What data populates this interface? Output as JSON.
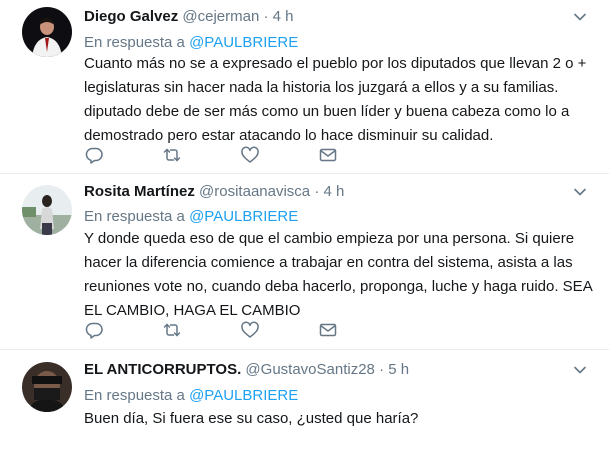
{
  "tweets": [
    {
      "name": "Diego Galvez",
      "handle": "@cejerman",
      "dot": "·",
      "time": "4 h",
      "reply_prefix": "En respuesta a",
      "reply_to": "@PAULBRIERE",
      "text": "Cuanto más no se a expresado el pueblo por los diputados que llevan 2 o + legislaturas sin hacer nada la historia los juzgará a ellos y a su familias. diputado debe de ser más como un buen líder y buena cabeza como lo a demostrado pero estar atacando lo hace disminuir su calidad."
    },
    {
      "name": "Rosita Martínez",
      "handle": "@rositaanavisca",
      "dot": "·",
      "time": "4 h",
      "reply_prefix": "En respuesta a",
      "reply_to": "@PAULBRIERE",
      "text": "Y donde queda eso de que el cambio empieza por una persona. Si quiere hacer la diferencia comience a trabajar en contra del sistema, asista a las reuniones vote no, cuando deba hacerlo, proponga, luche y haga ruido. SEA EL CAMBIO, HAGA EL CAMBIO"
    },
    {
      "name": "EL ANTICORRUPTOS.",
      "handle": "@GustavoSantiz28",
      "dot": "·",
      "time": "5 h",
      "reply_prefix": "En respuesta a",
      "reply_to": "@PAULBRIERE",
      "text": "Buen día, Si fuera ese su caso, ¿usted que haría?"
    }
  ],
  "icons": [
    "reply-icon",
    "retweet-icon",
    "like-icon",
    "direct-message-icon",
    "chevron-down-icon"
  ],
  "colors": {
    "link": "#1da1f2",
    "muted": "#657786",
    "text": "#14171a",
    "divider": "#e6ecf0"
  }
}
